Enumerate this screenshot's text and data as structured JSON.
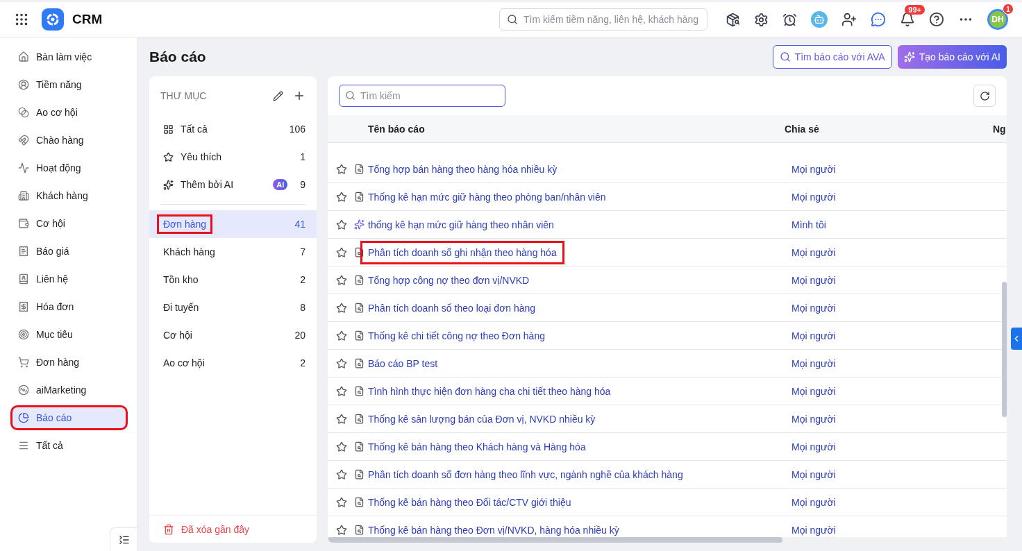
{
  "app": {
    "name": "CRM"
  },
  "global_search": {
    "placeholder": "Tìm kiếm tiềm năng, liên hệ, khách hàng"
  },
  "notifications": {
    "badge": "99+"
  },
  "user": {
    "initials": "DH",
    "badge": "1"
  },
  "sidebar": {
    "items": [
      {
        "label": "Bàn làm việc",
        "selected": false,
        "highlighted": false
      },
      {
        "label": "Tiềm năng",
        "selected": false,
        "highlighted": false
      },
      {
        "label": "Ao cơ hội",
        "selected": false,
        "highlighted": false
      },
      {
        "label": "Chào hàng",
        "selected": false,
        "highlighted": false
      },
      {
        "label": "Hoạt động",
        "selected": false,
        "highlighted": false
      },
      {
        "label": "Khách hàng",
        "selected": false,
        "highlighted": false
      },
      {
        "label": "Cơ hội",
        "selected": false,
        "highlighted": false
      },
      {
        "label": "Báo giá",
        "selected": false,
        "highlighted": false
      },
      {
        "label": "Liên hệ",
        "selected": false,
        "highlighted": false
      },
      {
        "label": "Hóa đơn",
        "selected": false,
        "highlighted": false
      },
      {
        "label": "Mục tiêu",
        "selected": false,
        "highlighted": false
      },
      {
        "label": "Đơn hàng",
        "selected": false,
        "highlighted": false
      },
      {
        "label": "aiMarketing",
        "selected": false,
        "highlighted": false
      },
      {
        "label": "Báo cáo",
        "selected": true,
        "highlighted": true
      },
      {
        "label": "Tất cả",
        "selected": false,
        "highlighted": false
      }
    ]
  },
  "page": {
    "title": "Báo cáo",
    "buttons": [
      {
        "kind": "outline",
        "label": "Tìm báo cáo với AVA"
      },
      {
        "kind": "gradient",
        "label": "Tạo báo cáo với AI"
      }
    ]
  },
  "folders": {
    "heading": "THƯ MỤC",
    "pinned": [
      {
        "kind": "all",
        "label": "Tất cả",
        "count": "106"
      },
      {
        "kind": "favorite",
        "label": "Yêu thích",
        "count": "1"
      },
      {
        "kind": "ai",
        "label": "Thêm bởi AI",
        "badge": "AI",
        "count": "9"
      }
    ],
    "items": [
      {
        "label": "Đơn hàng",
        "count": "41",
        "selected": true,
        "highlighted": true
      },
      {
        "label": "Khách hàng",
        "count": "7",
        "selected": false,
        "highlighted": false
      },
      {
        "label": "Tồn kho",
        "count": "2",
        "selected": false,
        "highlighted": false
      },
      {
        "label": "Đi tuyến",
        "count": "8",
        "selected": false,
        "highlighted": false
      },
      {
        "label": "Cơ hội",
        "count": "20",
        "selected": false,
        "highlighted": false
      },
      {
        "label": "Ao cơ hội",
        "count": "2",
        "selected": false,
        "highlighted": false
      }
    ],
    "trash": "Đã xóa gần đây"
  },
  "table": {
    "search": {
      "placeholder": "Tìm kiếm"
    },
    "columns": [
      "Tên báo cáo",
      "Chia sẻ",
      "Ng"
    ],
    "rows": [
      {
        "kind": "report",
        "name": "Tổng hợp bán hàng theo hàng hóa nhiều kỳ",
        "share": "Mọi người",
        "highlighted": false
      },
      {
        "kind": "report",
        "name": "Thống kê hạn mức giữ hàng theo phòng ban/nhân viên",
        "share": "Mọi người",
        "highlighted": false
      },
      {
        "kind": "ai",
        "name": "thống kê hạn mức giữ hàng theo nhân viên",
        "share": "Mình tôi",
        "highlighted": false
      },
      {
        "kind": "report",
        "name": "Phân tích doanh số ghi nhận theo hàng hóa",
        "share": "Mọi người",
        "highlighted": true
      },
      {
        "kind": "report",
        "name": "Tổng hợp công nợ theo đơn vị/NVKD",
        "share": "Mọi người",
        "highlighted": false
      },
      {
        "kind": "report",
        "name": "Phân tích doanh số theo loại đơn hàng",
        "share": "Mọi người",
        "highlighted": false
      },
      {
        "kind": "report",
        "name": "Thống kê chi tiết công nợ theo Đơn hàng",
        "share": "Mọi người",
        "highlighted": false
      },
      {
        "kind": "report",
        "name": "Báo cáo BP test",
        "share": "Mọi người",
        "highlighted": false
      },
      {
        "kind": "report",
        "name": "Tình hình thực hiện đơn hàng cha chi tiết theo hàng hóa",
        "share": "Mọi người",
        "highlighted": false
      },
      {
        "kind": "report",
        "name": "Thống kê sản lượng bán của Đơn vị, NVKD nhiều kỳ",
        "share": "Mọi người",
        "highlighted": false
      },
      {
        "kind": "report",
        "name": "Thống kê bán hàng theo Khách hàng và Hàng hóa",
        "share": "Mọi người",
        "highlighted": false
      },
      {
        "kind": "report",
        "name": "Phân tích doanh số đơn hàng theo lĩnh vực, ngành nghề của khách hàng",
        "share": "Mọi người",
        "highlighted": false
      },
      {
        "kind": "report",
        "name": "Thống kê bán hàng theo Đối tác/CTV giới thiệu",
        "share": "Mọi người",
        "highlighted": false
      },
      {
        "kind": "report",
        "name": "Thống kê bán hàng theo Đơn vị/NVKD, hàng hóa nhiều kỳ",
        "share": "Mọi người",
        "highlighted": false
      }
    ]
  }
}
